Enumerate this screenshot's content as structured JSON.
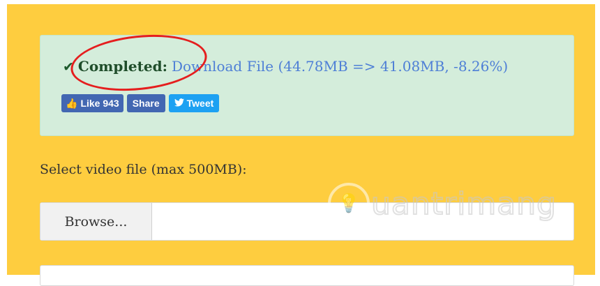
{
  "result": {
    "status_icon": "check-icon",
    "status_label": "Completed:",
    "download_text": "Download File (44.78MB => 41.08MB, -8.26%)"
  },
  "social": {
    "like_label": "Like 943",
    "share_label": "Share",
    "tweet_label": "Tweet"
  },
  "upload": {
    "label": "Select video file (max 500MB):",
    "browse_label": "Browse...",
    "file_value": ""
  },
  "watermark": {
    "text": "uantrimang"
  },
  "colors": {
    "panel_bg": "#fecd3f",
    "alert_bg": "#d4eddb",
    "link": "#4e7fd6",
    "highlight": "#e51e1e",
    "facebook": "#4267b2",
    "twitter": "#1da1f2"
  }
}
